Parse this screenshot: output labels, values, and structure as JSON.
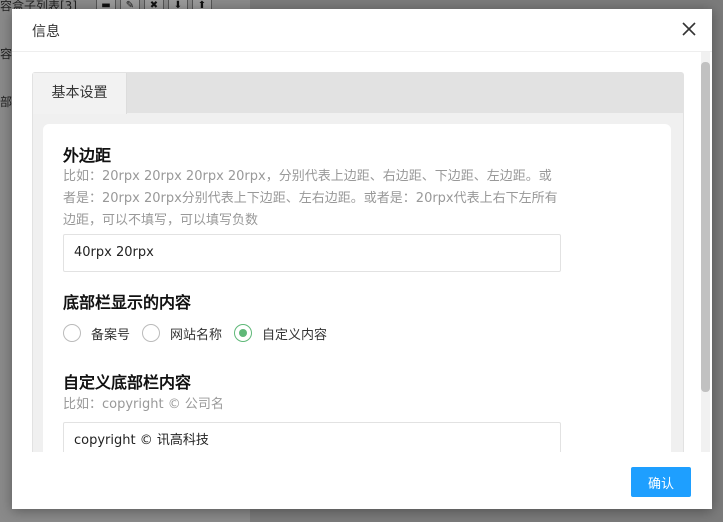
{
  "background": {
    "line1": "容盒子列表[3]",
    "line2": "容",
    "line3": "部",
    "toolbar_icons": [
      "save-icon",
      "edit-icon",
      "delete-icon",
      "move-down-icon",
      "move-up-icon"
    ]
  },
  "modal": {
    "title": "信息",
    "close_icon": "close-icon"
  },
  "tabs": [
    {
      "label": "基本设置",
      "active": true
    }
  ],
  "form": {
    "margin": {
      "label": "外边距",
      "hint": "比如：20rpx 20rpx 20rpx 20rpx，分别代表上边距、右边距、下边距、左边距。或者是：20rpx 20rpx分别代表上下边距、左右边距。或者是：20rpx代表上右下左所有边距，可以不填写，可以填写负数",
      "value": "40rpx 20rpx"
    },
    "footer_content": {
      "label": "底部栏显示的内容",
      "options": [
        {
          "label": "备案号",
          "checked": false
        },
        {
          "label": "网站名称",
          "checked": false
        },
        {
          "label": "自定义内容",
          "checked": true
        }
      ]
    },
    "custom_footer": {
      "label": "自定义底部栏内容",
      "hint": "比如：copyright © 公司名",
      "value": "copyright © 讯高科技"
    }
  },
  "footer": {
    "confirm_label": "确认"
  },
  "colors": {
    "accent": "#1e9fff",
    "radio_checked": "#5fb878"
  }
}
